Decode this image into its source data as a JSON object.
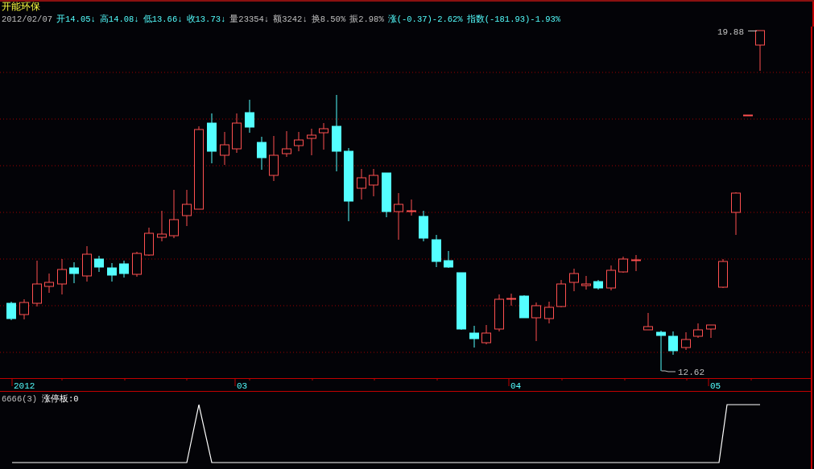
{
  "stock": {
    "name": "开能环保"
  },
  "quote": {
    "date": "2012/02/07",
    "items": [
      {
        "text": "开14.05",
        "arrow": "↓",
        "kind": "price"
      },
      {
        "text": "高14.08",
        "arrow": "↓",
        "kind": "price"
      },
      {
        "text": "低13.66",
        "arrow": "↓",
        "kind": "price"
      },
      {
        "text": "收13.73",
        "arrow": "↓",
        "kind": "price"
      },
      {
        "text": "量23354",
        "arrow": "↓",
        "kind": "volume"
      },
      {
        "text": "额3242",
        "arrow": "↓",
        "kind": "volume"
      },
      {
        "text": "换8.50%",
        "kind": "volume"
      },
      {
        "text": "振2.98%",
        "kind": "volume"
      },
      {
        "text": "涨(-0.37)-2.62%",
        "kind": "price"
      },
      {
        "text": "指数(-181.93)-1.93%",
        "kind": "price"
      }
    ]
  },
  "price_marks": {
    "high": "19.88",
    "low": "12.62"
  },
  "axis": {
    "labels": [
      "2012",
      "03",
      "04",
      "05"
    ]
  },
  "indicator": {
    "name": "6666(3)",
    "label": "涨停板:0"
  }
}
